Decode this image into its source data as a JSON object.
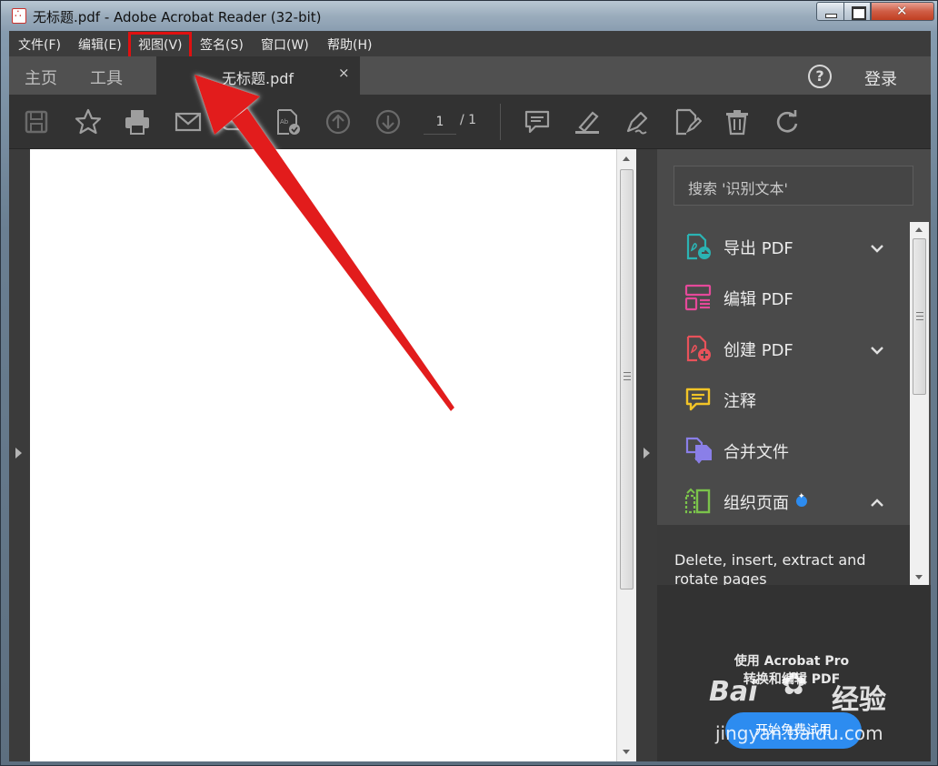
{
  "window": {
    "title": "无标题.pdf - Adobe Acrobat Reader (32-bit)",
    "controls": {
      "minimize": "minimize",
      "maximize": "maximize",
      "close": "close"
    }
  },
  "menubar": {
    "items": [
      {
        "label": "文件(F)"
      },
      {
        "label": "编辑(E)"
      },
      {
        "label": "视图(V)",
        "highlighted": true
      },
      {
        "label": "签名(S)"
      },
      {
        "label": "窗口(W)"
      },
      {
        "label": "帮助(H)"
      }
    ]
  },
  "tabs": {
    "home": "主页",
    "tools": "工具",
    "document": "无标题.pdf",
    "close_glyph": "×",
    "help_glyph": "?",
    "login": "登录"
  },
  "toolbar": {
    "icons": [
      "save-icon",
      "bookmark-star-icon",
      "print-icon",
      "email-icon",
      "upload-cloud-icon",
      "spellcheck-doc-icon",
      "page-up-icon",
      "page-down-icon",
      "comment-icon",
      "highlight-pen-icon",
      "sign-pen-icon",
      "fill-sign-icon",
      "delete-icon",
      "rotate-icon"
    ],
    "current_page": "1",
    "page_total": "/ 1"
  },
  "right_pane": {
    "search_placeholder": "搜索 '识别文本'",
    "tools": [
      {
        "label": "导出 PDF",
        "icon": "export-pdf-icon",
        "color": "#2bb3b3",
        "expandable": true
      },
      {
        "label": "编辑 PDF",
        "icon": "edit-pdf-icon",
        "color": "#e5499a",
        "expandable": false
      },
      {
        "label": "创建 PDF",
        "icon": "create-pdf-icon",
        "color": "#e8525a",
        "expandable": true
      },
      {
        "label": "注释",
        "icon": "comment-tool-icon",
        "color": "#f2c427",
        "expandable": false
      },
      {
        "label": "合并文件",
        "icon": "combine-files-icon",
        "color": "#8a7fe8",
        "expandable": false
      },
      {
        "label": "组织页面",
        "icon": "organize-pages-icon",
        "color": "#7bc34b",
        "expandable": true,
        "expanded": true,
        "badge": true
      }
    ],
    "description": "Delete, insert, extract and rotate pages",
    "promo_line1": "使用 Acrobat Pro",
    "promo_line2": "转换和编辑 PDF",
    "trial_button": "开始免费试用"
  },
  "watermark": {
    "brand": "Bai",
    "suffix": "经验",
    "url": "jingyan.baidu.com"
  },
  "colors": {
    "annotation_red": "#e01010",
    "accent_blue": "#2d8cf0"
  }
}
